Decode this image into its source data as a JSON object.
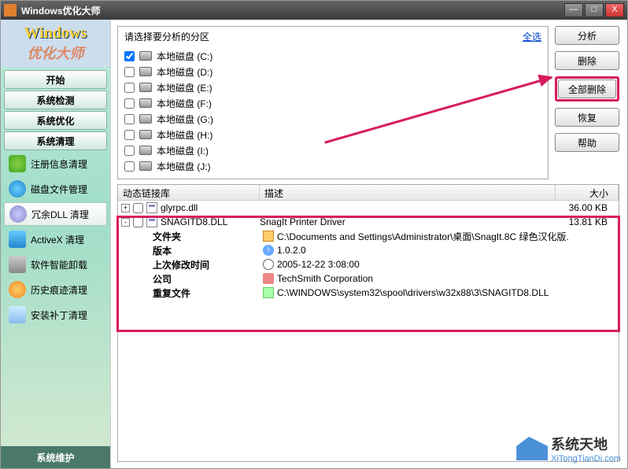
{
  "titlebar": {
    "title": "Windows优化大师"
  },
  "logo": {
    "line1": "Windows",
    "line2": "优化大师"
  },
  "nav": {
    "start": "开始",
    "groups": [
      "系统检测",
      "系统优化",
      "系统清理"
    ],
    "items": [
      {
        "label": "注册信息清理"
      },
      {
        "label": "磁盘文件管理"
      },
      {
        "label": "冗余DLL 清理",
        "active": true
      },
      {
        "label": "ActiveX 清理"
      },
      {
        "label": "软件智能卸载"
      },
      {
        "label": "历史痕迹清理"
      },
      {
        "label": "安装补丁清理"
      }
    ],
    "bottom": "系统维护"
  },
  "partitions": {
    "prompt": "请选择要分析的分区",
    "select_all": "全选",
    "drives": [
      {
        "label": "本地磁盘 (C:)",
        "checked": true
      },
      {
        "label": "本地磁盘 (D:)",
        "checked": false
      },
      {
        "label": "本地磁盘 (E:)",
        "checked": false
      },
      {
        "label": "本地磁盘 (F:)",
        "checked": false
      },
      {
        "label": "本地磁盘 (G:)",
        "checked": false
      },
      {
        "label": "本地磁盘 (H:)",
        "checked": false
      },
      {
        "label": "本地磁盘 (I:)",
        "checked": false
      },
      {
        "label": "本地磁盘 (J:)",
        "checked": false
      }
    ]
  },
  "actions": {
    "analyze": "分析",
    "delete": "删除",
    "delete_all": "全部删除",
    "restore": "恢复",
    "help": "帮助"
  },
  "list": {
    "headers": {
      "name": "动态链接库",
      "desc": "描述",
      "size": "大小"
    },
    "rows": [
      {
        "name": "glyrpc.dll",
        "desc": "",
        "size": "36.00 KB"
      },
      {
        "name": "SNAGITD8.DLL",
        "desc": "SnagIt Printer Driver",
        "size": "13.81 KB"
      }
    ],
    "details": {
      "folder_label": "文件夹",
      "folder_value": "C:\\Documents and Settings\\Administrator\\桌面\\SnagIt.8C 绿色汉化版.",
      "version_label": "版本",
      "version_value": "1.0.2.0",
      "mtime_label": "上次修改时间",
      "mtime_value": "2005-12-22 3:08:00",
      "company_label": "公司",
      "company_value": "TechSmith Corporation",
      "dup_label": "重复文件",
      "dup_value": "C:\\WINDOWS\\system32\\spool\\drivers\\w32x88\\3\\SNAGITD8.DLL"
    }
  },
  "watermark": {
    "brand": "系统天地",
    "url": "XiTongTianDi.com"
  }
}
